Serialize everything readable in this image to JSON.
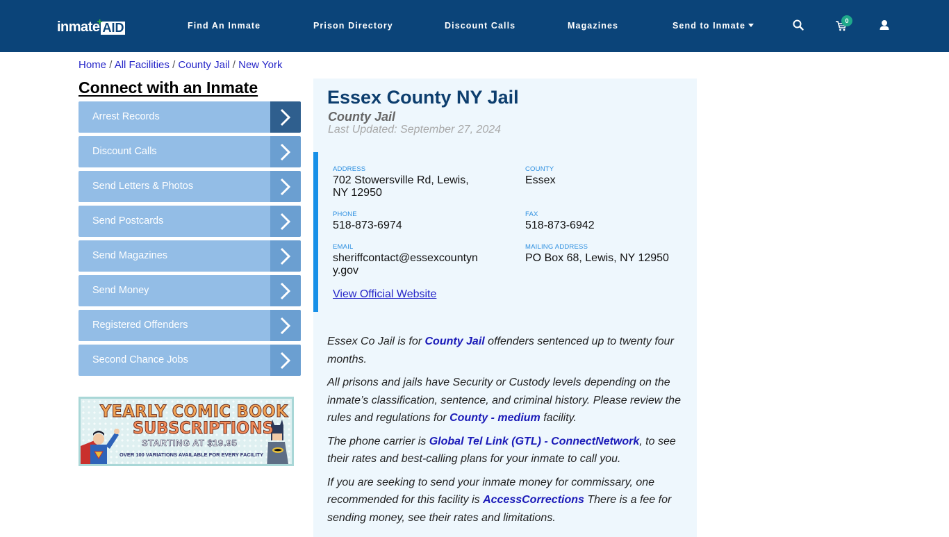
{
  "header": {
    "logo": {
      "part1": "inmate",
      "part2": "AID"
    },
    "nav": [
      {
        "label": "Find An Inmate"
      },
      {
        "label": "Prison Directory"
      },
      {
        "label": "Discount Calls"
      },
      {
        "label": "Magazines"
      },
      {
        "label": "Send to Inmate",
        "dropdown": true
      }
    ],
    "icons": [
      "search-icon",
      "cart-icon",
      "user-icon"
    ],
    "cart_count": "0"
  },
  "breadcrumb": [
    "Home",
    "All Facilities",
    "County Jail",
    "New York"
  ],
  "sidebar": {
    "title": "Connect with an Inmate",
    "items": [
      {
        "label": "Arrest Records"
      },
      {
        "label": "Discount Calls"
      },
      {
        "label": "Send Letters & Photos"
      },
      {
        "label": "Send Postcards"
      },
      {
        "label": "Send Magazines"
      },
      {
        "label": "Send Money"
      },
      {
        "label": "Registered Offenders"
      },
      {
        "label": "Second Chance Jobs"
      }
    ],
    "ad": {
      "line1": "YEARLY COMIC BOOK",
      "line2": "SUBSCRIPTIONS",
      "line3": "STARTING AT $19.95",
      "line4": "OVER 100 VARIATIONS AVAILABLE FOR EVERY FACILITY"
    }
  },
  "facility": {
    "name": "Essex County NY Jail",
    "type": "County Jail",
    "last_updated": "Last Updated: September 27, 2024",
    "fields": {
      "address": {
        "label": "ADDRESS",
        "value": "702 Stowersville Rd, Lewis, NY 12950"
      },
      "county": {
        "label": "COUNTY",
        "value": "Essex"
      },
      "phone": {
        "label": "PHONE",
        "value": "518-873-6974"
      },
      "fax": {
        "label": "FAX",
        "value": "518-873-6942"
      },
      "email": {
        "label": "EMAIL",
        "value": "sheriffcontact@essexcountyny.gov"
      },
      "mailing": {
        "label": "MAILING ADDRESS",
        "value": "PO Box 68, Lewis, NY 12950"
      }
    },
    "website_label": "View Official Website"
  },
  "description": {
    "p1": {
      "a": "Essex Co Jail is for ",
      "link": "County Jail",
      "b": " offenders sentenced up to twenty four months."
    },
    "p2": {
      "a": "All prisons and jails have Security or Custody levels depending on the inmate’s classification, sentence, and criminal history. Please review the rules and regulations for ",
      "link": "County - medium",
      "b": " facility."
    },
    "p3": {
      "a": "The phone carrier is ",
      "link": "Global Tel Link (GTL) - ConnectNetwork",
      "b": ", to see their rates and best-calling plans for your inmate to call you."
    },
    "p4": {
      "a": "If you are seeking to send your inmate money for commissary, one recommended for this facility is ",
      "link": "AccessCorrections",
      "b": " There is a fee for sending money, see their rates and limitations."
    }
  }
}
